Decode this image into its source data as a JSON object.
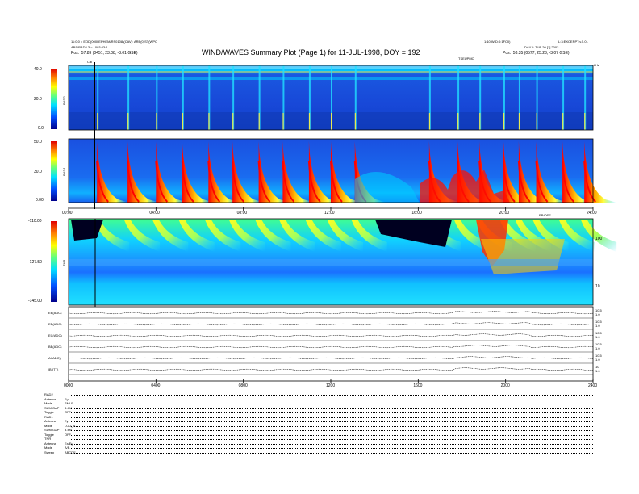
{
  "header": {
    "left_line1": "11:0:0 = EOD(0000EPHEM/RS0108)(CAV): ARE(0)ST(WPC",
    "left_line2": "ABS/RAD2 3 = 1003:03:1",
    "left_line3_label": "Pos.",
    "left_line3_value": "57.89 (0451, 23.08, -3.01 GSE)",
    "title": "WIND/WAVES Summary Plot (Page 1) for 11-JUL-1998, DOY = 192",
    "right_line1": "1:10:W(D:0:1FC0)",
    "right_line2": "DAILY: TUE 20 [?] 2002",
    "right_line3_label": "Pos.",
    "right_line3_value": "58.35 (0577, 25.23, -3.07 GSE)",
    "far_right": "L:3:EXCERPT:v.5.01"
  },
  "marker_labels": {
    "cal": "Cal",
    "sfe_ma": "TSEUPMC",
    "sfe_mb": "EP/OSE",
    "khz": "kHz"
  },
  "colorbar": {
    "rad2_ticks": [
      "40.0",
      "20.0",
      "0.0"
    ],
    "rad1_ticks": [
      "50.0",
      "30.0",
      "0.00"
    ],
    "tnr_ticks": [
      "-110.00",
      "-127.50",
      "-145.00"
    ],
    "rad2_label": "RAD2",
    "rad1_label": "RAD1",
    "tnr_label": "TNR"
  },
  "time_axis": {
    "upper": [
      "00:00",
      "04:00",
      "08:00",
      "12:00",
      "16:00",
      "20:00",
      "24:00"
    ],
    "lower": [
      "0000",
      "0400",
      "0800",
      "1200",
      "1600",
      "2000",
      "2400"
    ]
  },
  "tnr_right_ticks": [
    "100",
    "10"
  ],
  "traces": [
    {
      "label": "EE(ADC)",
      "right": "10.5\n1.0"
    },
    {
      "label": "EB(ADC)",
      "right": "10.5\n1.0"
    },
    {
      "label": "EC(ADC)",
      "right": "10.5\n1.0"
    },
    {
      "label": "BB(ADC)",
      "right": "10.5\n1.0"
    },
    {
      "label": "AI(ADC)",
      "right": "10.5\n1.0"
    },
    {
      "label": "|B|(TT)",
      "right": "10\n1.0"
    }
  ],
  "bottom_block": [
    {
      "label": "RAD2",
      "value": ""
    },
    {
      "label": "Antenna",
      "value": "Ey"
    },
    {
      "label": "Mode",
      "value": "SMLE"
    },
    {
      "label": "SUM/GAP",
      "value": "3.4M"
    },
    {
      "label": "Toggle",
      "value": "OFF"
    },
    {
      "label": "RAD1",
      "value": ""
    },
    {
      "label": "Antenna",
      "value": "Ey"
    },
    {
      "label": "Mode",
      "value": "LOG_A"
    },
    {
      "label": "SUM/GAP",
      "value": "3.4M"
    },
    {
      "label": "Toggle",
      "value": "OFF"
    },
    {
      "label": "TNR",
      "value": ""
    },
    {
      "label": "Antenna",
      "value": "Ex/Ey"
    },
    {
      "label": "Mode",
      "value": "A/B"
    },
    {
      "label": "Sweep",
      "value": "ABCDE"
    }
  ],
  "chart_data": {
    "type": "heatmap",
    "title": "WIND/WAVES Summary Plot (Page 1) for 11-JUL-1998, DOY = 192",
    "x_range_hours": [
      0,
      24
    ],
    "panels": [
      {
        "name": "RAD2",
        "colorbar_range_db": [
          0,
          40
        ]
      },
      {
        "name": "RAD1",
        "colorbar_range_db": [
          0,
          50
        ]
      },
      {
        "name": "TNR",
        "colorbar_range_dbv": [
          -145,
          -110
        ]
      }
    ],
    "type3_burst_times_hours": [
      1.3,
      2.7,
      4.0,
      5.2,
      6.4,
      7.5,
      8.7,
      9.8,
      11.0,
      12.0,
      13.1,
      16.5,
      17.8,
      18.8,
      19.9,
      20.6,
      21.4,
      22.6,
      23.6
    ],
    "cal_marker_hour": 1.2
  }
}
